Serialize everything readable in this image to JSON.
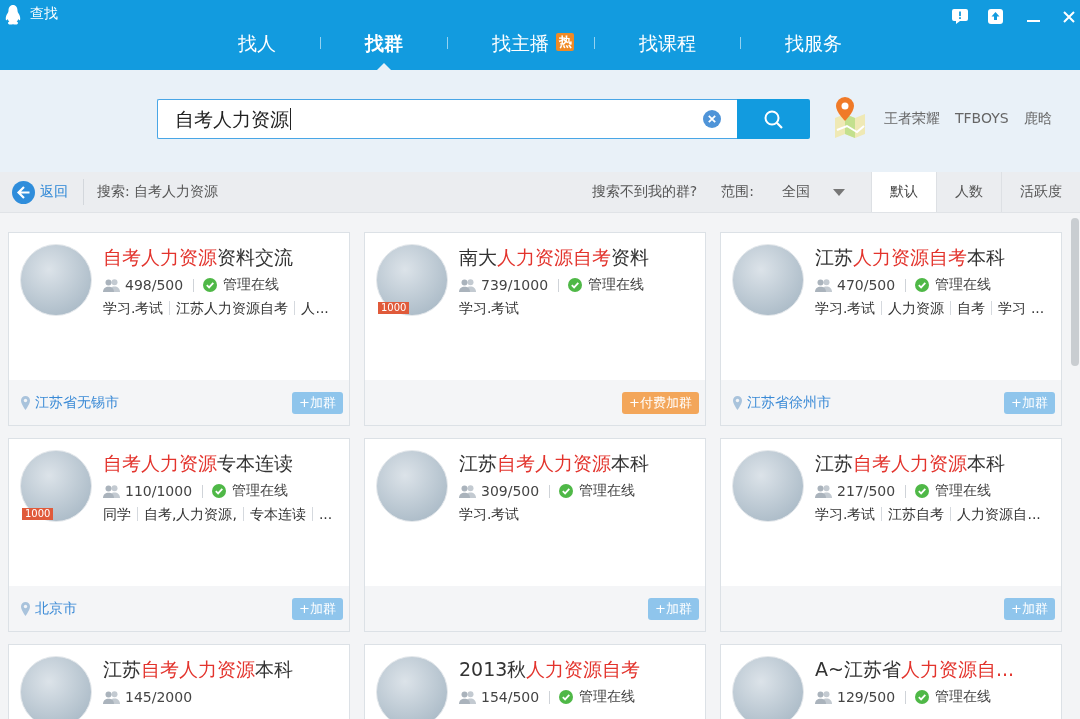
{
  "window": {
    "title": "查找"
  },
  "nav_tabs": [
    {
      "label": "找人",
      "selected": false
    },
    {
      "label": "找群",
      "selected": true
    },
    {
      "label": "找主播",
      "selected": false,
      "badge": "热"
    },
    {
      "label": "找课程",
      "selected": false
    },
    {
      "label": "找服务",
      "selected": false
    }
  ],
  "search": {
    "value": "自考人力资源"
  },
  "hot_words": [
    "王者荣耀",
    "TFBOYS",
    "鹿晗"
  ],
  "filter_bar": {
    "back": "返回",
    "query_label": "搜索: 自考人力资源",
    "help_link": "搜索不到我的群?",
    "scope_label": "范围:",
    "scope_value": "全国",
    "sort_tabs": [
      {
        "label": "默认",
        "selected": true
      },
      {
        "label": "人数",
        "selected": false
      },
      {
        "label": "活跃度",
        "selected": false
      }
    ]
  },
  "groups": [
    {
      "title": [
        {
          "text": "自考人力资源",
          "highlight": true
        },
        {
          "text": "资料交流",
          "highlight": false
        }
      ],
      "count": "498/500",
      "admin": "管理在线",
      "tags": [
        "学习.考试",
        "江苏人力资源自考",
        "人..."
      ],
      "location": "江苏省无锡市",
      "join": {
        "kind": "free",
        "label": "+加群"
      }
    },
    {
      "title": [
        {
          "text": "南大",
          "highlight": false
        },
        {
          "text": "人力资源自考",
          "highlight": true
        },
        {
          "text": "资料",
          "highlight": false
        }
      ],
      "badge": "1000",
      "count": "739/1000",
      "admin": "管理在线",
      "tags": [
        "学习.考试"
      ],
      "join": {
        "kind": "paid",
        "label": "+付费加群"
      }
    },
    {
      "title": [
        {
          "text": "江苏",
          "highlight": false
        },
        {
          "text": "人力资源自考",
          "highlight": true
        },
        {
          "text": "本科",
          "highlight": false
        }
      ],
      "count": "470/500",
      "admin": "管理在线",
      "tags": [
        "学习.考试",
        "人力资源",
        "自考",
        "学习 ..."
      ],
      "location": "江苏省徐州市",
      "join": {
        "kind": "free",
        "label": "+加群"
      }
    },
    {
      "title": [
        {
          "text": "自考人力资源",
          "highlight": true
        },
        {
          "text": "专本连读",
          "highlight": false
        }
      ],
      "badge": "1000",
      "count": "110/1000",
      "admin": "管理在线",
      "tags": [
        "同学",
        "自考,人力资源,",
        "专本连读",
        "..."
      ],
      "location": "北京市",
      "join": {
        "kind": "free",
        "label": "+加群"
      }
    },
    {
      "title": [
        {
          "text": "江苏",
          "highlight": false
        },
        {
          "text": "自考人力资源",
          "highlight": true
        },
        {
          "text": "本科",
          "highlight": false
        }
      ],
      "count": "309/500",
      "admin": "管理在线",
      "tags": [
        "学习.考试"
      ],
      "join": {
        "kind": "free",
        "label": "+加群"
      }
    },
    {
      "title": [
        {
          "text": "江苏",
          "highlight": false
        },
        {
          "text": "自考人力资源",
          "highlight": true
        },
        {
          "text": "本科",
          "highlight": false
        }
      ],
      "count": "217/500",
      "admin": "管理在线",
      "tags": [
        "学习.考试",
        "江苏自考",
        "人力资源自..."
      ],
      "join": {
        "kind": "free",
        "label": "+加群"
      }
    },
    {
      "title": [
        {
          "text": "江苏",
          "highlight": false
        },
        {
          "text": "自考人力资源",
          "highlight": true
        },
        {
          "text": "本科",
          "highlight": false
        }
      ],
      "count": "145/2000"
    },
    {
      "title": [
        {
          "text": "2013秋",
          "highlight": false
        },
        {
          "text": "人力资源自考",
          "highlight": true
        }
      ],
      "count": "154/500",
      "admin": "管理在线"
    },
    {
      "title": [
        {
          "text": "A~江苏省",
          "highlight": false
        },
        {
          "text": "人力资源自...",
          "highlight": true
        }
      ],
      "count": "129/500",
      "admin": "管理在线"
    }
  ]
}
